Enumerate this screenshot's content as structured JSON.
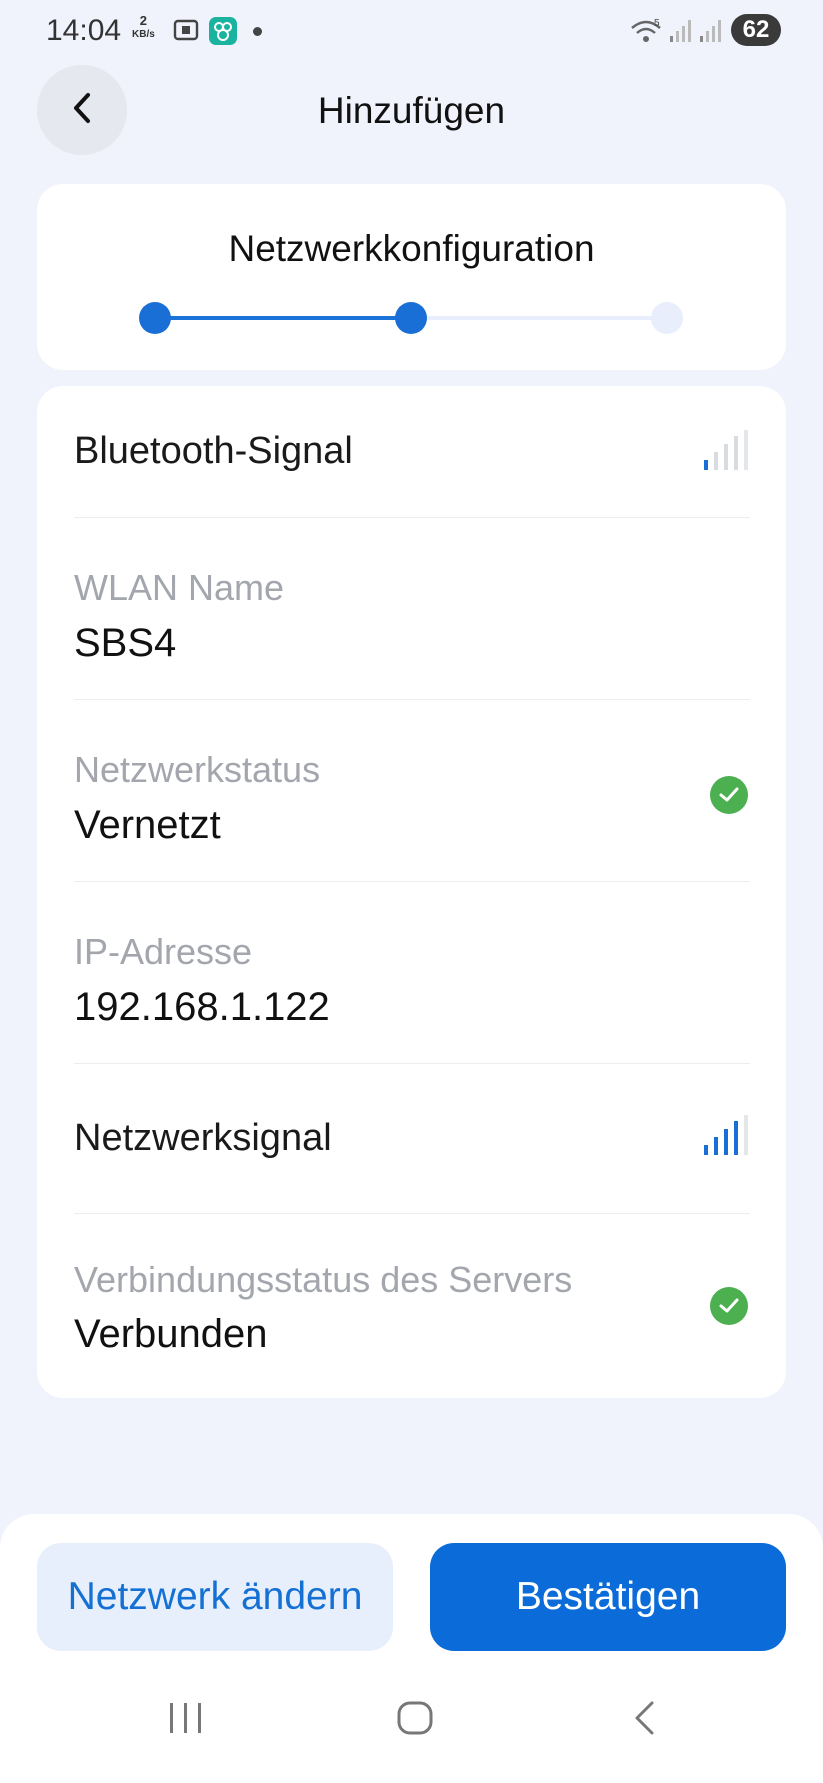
{
  "status_bar": {
    "time": "14:04",
    "speed_value": "2",
    "speed_unit": "KB/s",
    "battery": "62"
  },
  "header": {
    "title": "Hinzufügen",
    "back_icon": "chevron-left-icon"
  },
  "stepper": {
    "title": "Netzwerkkonfiguration",
    "total_steps": 3,
    "current_step": 2
  },
  "info": {
    "bluetooth": {
      "label": "Bluetooth-Signal",
      "signal_level": 1,
      "signal_max": 4
    },
    "wlan": {
      "label": "WLAN Name",
      "value": "SBS4"
    },
    "network_status": {
      "label": "Netzwerkstatus",
      "value": "Vernetzt",
      "icon": "check-circle-icon"
    },
    "ip": {
      "label": "IP-Adresse",
      "value": "192.168.1.122"
    },
    "network_signal": {
      "label": "Netzwerksignal",
      "signal_level": 3,
      "signal_max": 4
    },
    "server_status": {
      "label": "Verbindungsstatus des Servers",
      "value": "Verbunden",
      "icon": "check-circle-icon"
    }
  },
  "actions": {
    "change_network": "Netzwerk ändern",
    "confirm": "Bestätigen"
  },
  "colors": {
    "accent": "#0b6bd8",
    "success": "#4caf50",
    "background": "#f0f2fc"
  }
}
